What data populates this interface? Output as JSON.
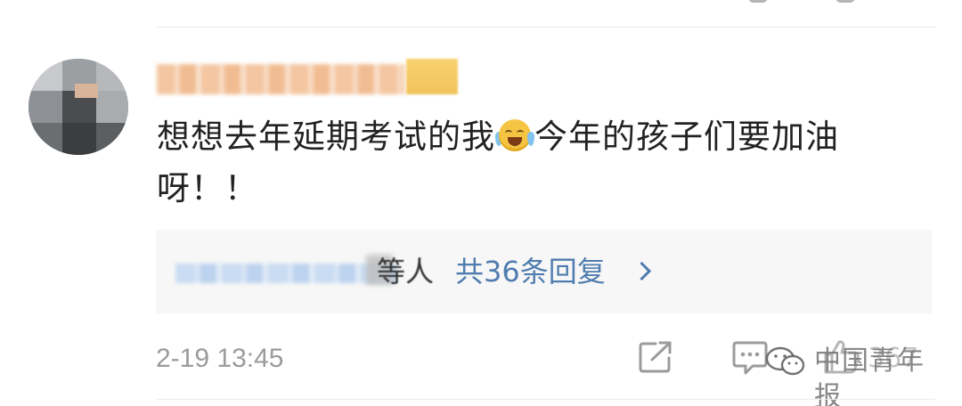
{
  "comment": {
    "text_line1": "想想去年延期考试的我",
    "emoji": "crying-face-icon",
    "text_line1_after_emoji": "今年的孩子们要加油",
    "text_line2": "呀！！"
  },
  "replies": {
    "suffix": "等人",
    "link_label": "共36条回复"
  },
  "footer": {
    "timestamp": "2-19 13:45",
    "like_count": "367",
    "icons": [
      "share-icon",
      "comment-icon",
      "like-icon"
    ]
  },
  "watermark": {
    "text": "中国青年报",
    "icon": "wechat-logo-icon"
  },
  "colors": {
    "link": "#507daf",
    "text": "#222222",
    "meta": "#9b9b9b",
    "reply_box_bg": "#f7f7f7"
  }
}
